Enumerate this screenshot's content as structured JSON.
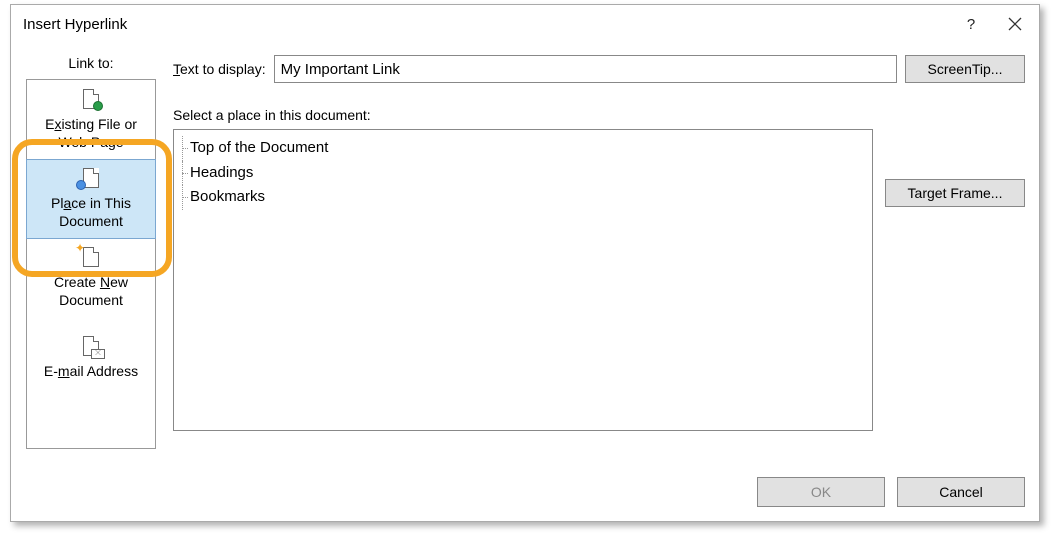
{
  "title": "Insert Hyperlink",
  "linkto": {
    "header": "Link to:",
    "items": [
      {
        "line1_before": "E",
        "line1_u": "x",
        "line1_after": "isting File or",
        "line2": "Web Page"
      },
      {
        "line1_before": "Pl",
        "line1_u": "a",
        "line1_after": "ce in This",
        "line2": "Document"
      },
      {
        "line1_before": "Create ",
        "line1_u": "N",
        "line1_after": "ew",
        "line2": "Document"
      },
      {
        "line1_before": "E-",
        "line1_u": "m",
        "line1_after": "ail Address",
        "line2": ""
      }
    ]
  },
  "labels": {
    "text_to_display_before": "",
    "text_to_display_u": "T",
    "text_to_display_after": "ext to display:",
    "select_place": "Select a place in this document:"
  },
  "fields": {
    "text_to_display_value": "My Important Link"
  },
  "tree": {
    "items": [
      "Top of the Document",
      "Headings",
      "Bookmarks"
    ]
  },
  "buttons": {
    "screentip": "ScreenTip...",
    "target_frame": "Tar",
    "target_frame_u": "g",
    "target_frame_after": "et Frame...",
    "ok": "OK",
    "cancel": "Cancel"
  }
}
